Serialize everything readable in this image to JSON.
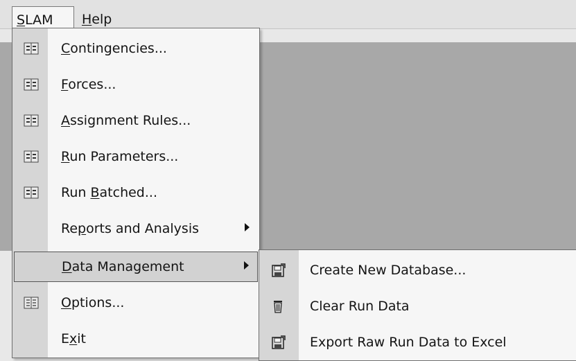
{
  "menubar": {
    "slam": {
      "before": "",
      "ul": "S",
      "after": "LAM"
    },
    "help": {
      "before": "",
      "ul": "H",
      "after": "elp"
    }
  },
  "slam_menu": {
    "items": [
      {
        "before": "",
        "ul": "C",
        "after": "ontingencies...",
        "icon": "grid-list-icon"
      },
      {
        "before": "",
        "ul": "F",
        "after": "orces...",
        "icon": "grid-list-icon"
      },
      {
        "before": "",
        "ul": "A",
        "after": "ssignment Rules...",
        "icon": "grid-list-icon"
      },
      {
        "before": "",
        "ul": "R",
        "after": "un Parameters...",
        "icon": "grid-list-icon"
      },
      {
        "before": "Run ",
        "ul": "B",
        "after": "atched...",
        "icon": "grid-list-icon"
      },
      {
        "before": "Re",
        "ul": "p",
        "after": "orts and Analysis",
        "has_submenu": true
      },
      {
        "before": "",
        "ul": "D",
        "after": "ata Management",
        "has_submenu": true,
        "highlighted": true
      },
      {
        "before": "",
        "ul": "O",
        "after": "ptions...",
        "icon": "options-table-icon"
      },
      {
        "before": "E",
        "ul": "x",
        "after": "it"
      }
    ]
  },
  "data_management_menu": {
    "items": [
      {
        "label": "Create New Database...",
        "icon": "save-database-icon"
      },
      {
        "label": "Clear Run Data",
        "icon": "trash-icon"
      },
      {
        "label": "Export Raw Run Data to Excel",
        "icon": "save-database-icon"
      }
    ]
  }
}
